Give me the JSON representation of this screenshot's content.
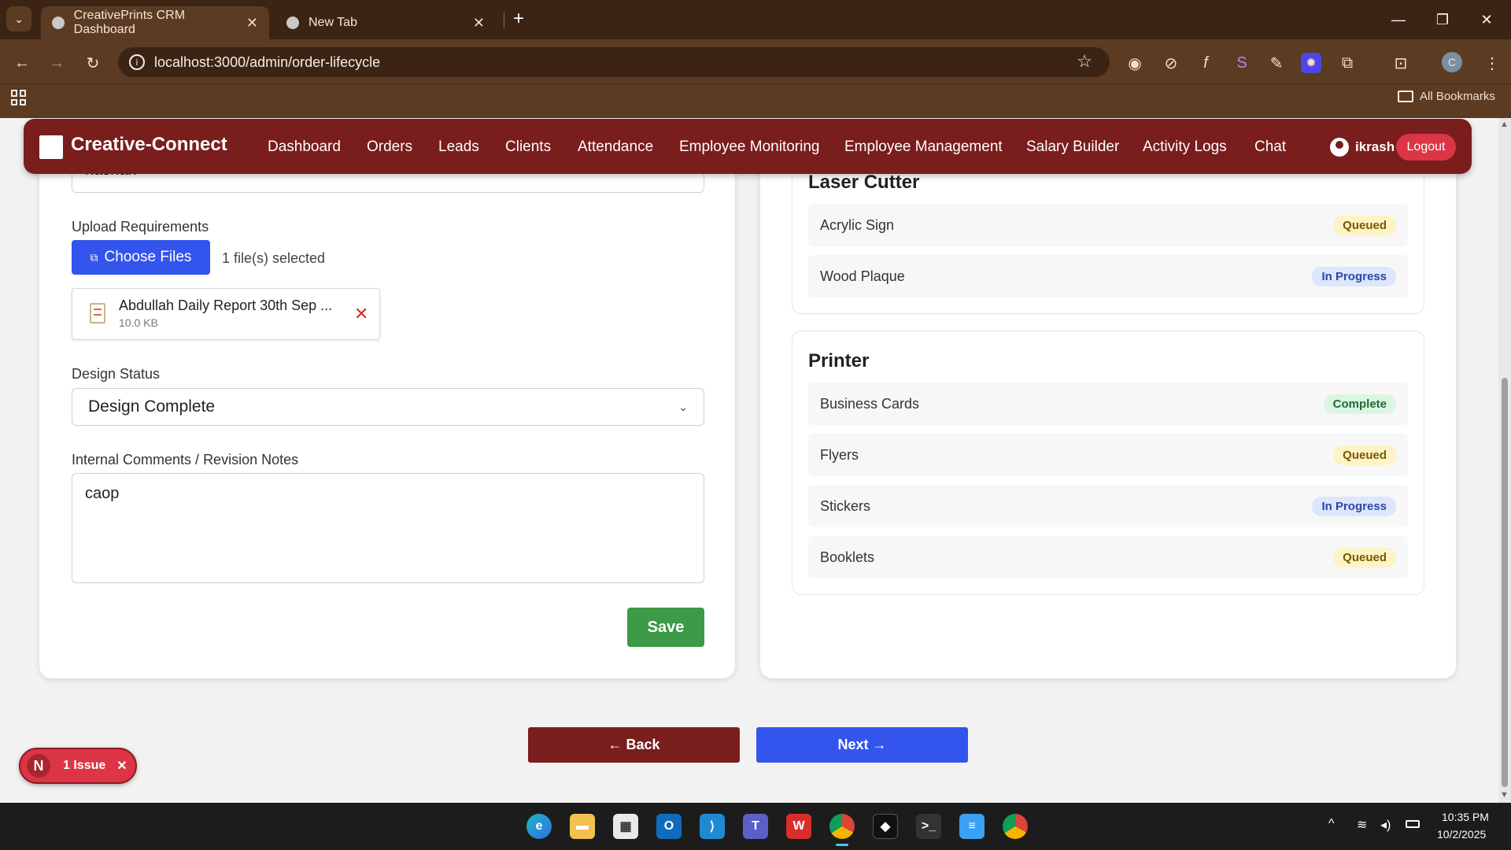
{
  "browser": {
    "tabs": [
      {
        "title": "CreativePrints CRM Dashboard",
        "active": true
      },
      {
        "title": "New Tab",
        "active": false
      }
    ],
    "url": "localhost:3000/admin/order-lifecycle",
    "bookmarks_label": "All Bookmarks",
    "profile_initial": "C"
  },
  "nav": {
    "brand": "Creative-Connect",
    "links": [
      "Dashboard",
      "Orders",
      "Leads",
      "Clients",
      "Attendance",
      "Employee Monitoring",
      "Employee Management",
      "Salary Builder",
      "Activity Logs",
      "Chat"
    ],
    "user": "ikrash",
    "logout": "Logout"
  },
  "form": {
    "prev_field_value": "nashan",
    "upload_label": "Upload Requirements",
    "choose_files": "Choose Files",
    "files_selected": "1 file(s) selected",
    "file": {
      "name": "Abdullah Daily Report 30th Sep ...",
      "size": "10.0 KB"
    },
    "design_status_label": "Design Status",
    "design_status_value": "Design Complete",
    "comments_label": "Internal Comments / Revision Notes",
    "comments_value": "caop",
    "save": "Save"
  },
  "machines": [
    {
      "name": "Laser Cutter",
      "jobs": [
        {
          "name": "Acrylic Sign",
          "status": "Queued"
        },
        {
          "name": "Wood Plaque",
          "status": "In Progress"
        }
      ]
    },
    {
      "name": "Printer",
      "jobs": [
        {
          "name": "Business Cards",
          "status": "Complete"
        },
        {
          "name": "Flyers",
          "status": "Queued"
        },
        {
          "name": "Stickers",
          "status": "In Progress"
        },
        {
          "name": "Booklets",
          "status": "Queued"
        }
      ]
    }
  ],
  "pager": {
    "back": "← Back",
    "next": "Next →"
  },
  "issues": {
    "avatar": "N",
    "label": "1 Issue"
  },
  "taskbar": {
    "time": "10:35 PM",
    "date": "10/2/2025"
  },
  "colors": {
    "nav": "#7a1d1d",
    "primary": "#3355ee",
    "save": "#3d9a47",
    "back": "#7a1d1d"
  }
}
